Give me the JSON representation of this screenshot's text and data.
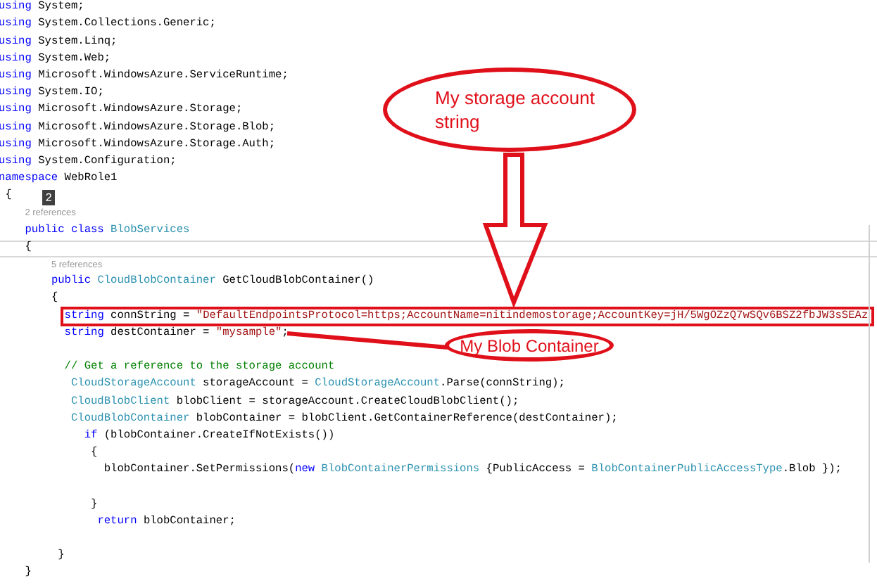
{
  "editor": {
    "lines": [
      {
        "kind": "code",
        "tokens": [
          {
            "kind": "keyword",
            "text": "using"
          },
          {
            "kind": "plain",
            "text": " System;"
          }
        ]
      },
      {
        "kind": "code",
        "tokens": [
          {
            "kind": "keyword",
            "text": "using"
          },
          {
            "kind": "plain",
            "text": " System.Collections.Generic;"
          }
        ]
      },
      {
        "kind": "code",
        "tokens": [
          {
            "kind": "keyword",
            "text": "using"
          },
          {
            "kind": "plain",
            "text": " System.Linq;"
          }
        ]
      },
      {
        "kind": "code",
        "tokens": [
          {
            "kind": "keyword",
            "text": "using"
          },
          {
            "kind": "plain",
            "text": " System.Web;"
          }
        ]
      },
      {
        "kind": "code",
        "tokens": [
          {
            "kind": "keyword",
            "text": "using"
          },
          {
            "kind": "plain",
            "text": " Microsoft.WindowsAzure.ServiceRuntime;"
          }
        ]
      },
      {
        "kind": "code",
        "tokens": [
          {
            "kind": "keyword",
            "text": "using"
          },
          {
            "kind": "plain",
            "text": " System.IO;"
          }
        ]
      },
      {
        "kind": "code",
        "tokens": [
          {
            "kind": "keyword",
            "text": "using"
          },
          {
            "kind": "plain",
            "text": " Microsoft.WindowsAzure.Storage;"
          }
        ]
      },
      {
        "kind": "code",
        "tokens": [
          {
            "kind": "keyword",
            "text": "using"
          },
          {
            "kind": "plain",
            "text": " Microsoft.WindowsAzure.Storage.Blob;"
          }
        ]
      },
      {
        "kind": "code",
        "tokens": [
          {
            "kind": "keyword",
            "text": "using"
          },
          {
            "kind": "plain",
            "text": " Microsoft.WindowsAzure.Storage.Auth;"
          }
        ]
      },
      {
        "kind": "code",
        "tokens": [
          {
            "kind": "keyword",
            "text": "using"
          },
          {
            "kind": "plain",
            "text": " System.Configuration;"
          }
        ]
      },
      {
        "kind": "code",
        "tokens": [
          {
            "kind": "keyword",
            "text": "namespace"
          },
          {
            "kind": "plain",
            "text": " WebRole1"
          }
        ]
      },
      {
        "kind": "code",
        "badge": "2",
        "tokens": [
          {
            "kind": "plain",
            "text": " {"
          }
        ]
      },
      {
        "kind": "lens",
        "text": "    2 references"
      },
      {
        "kind": "code",
        "tokens": [
          {
            "kind": "keyword",
            "text": "    public class"
          },
          {
            "kind": "type",
            "text": " BlobServices"
          }
        ]
      },
      {
        "kind": "code",
        "current": true,
        "tokens": [
          {
            "kind": "plain",
            "text": "    {"
          }
        ]
      },
      {
        "kind": "lens",
        "text": "        5 references"
      },
      {
        "kind": "code",
        "tokens": [
          {
            "kind": "keyword",
            "text": "        public"
          },
          {
            "kind": "type",
            "text": " CloudBlobContainer"
          },
          {
            "kind": "plain",
            "text": " GetCloudBlobContainer()"
          }
        ]
      },
      {
        "kind": "code",
        "tokens": [
          {
            "kind": "plain",
            "text": "        {"
          }
        ]
      },
      {
        "kind": "code",
        "highlighted": true,
        "tokens": [
          {
            "kind": "keyword",
            "text": "          string"
          },
          {
            "kind": "plain",
            "text": " connString = "
          },
          {
            "kind": "string",
            "text": "\"DefaultEndpointsProtocol=https;AccountName=nitindemostorage;AccountKey=jH/5WgOZzQ7wSQv6BSZ2fbJW3sSEAz"
          }
        ]
      },
      {
        "kind": "code",
        "tokens": [
          {
            "kind": "keyword",
            "text": "          string"
          },
          {
            "kind": "plain",
            "text": " destContainer = "
          },
          {
            "kind": "string",
            "text": "\"mysample\""
          },
          {
            "kind": "plain",
            "text": ";"
          }
        ]
      },
      {
        "kind": "blank"
      },
      {
        "kind": "code",
        "tokens": [
          {
            "kind": "comment",
            "text": "          // Get a reference to the storage account"
          }
        ]
      },
      {
        "kind": "code",
        "tokens": [
          {
            "kind": "type",
            "text": "           CloudStorageAccount"
          },
          {
            "kind": "plain",
            "text": " storageAccount = "
          },
          {
            "kind": "type",
            "text": "CloudStorageAccount"
          },
          {
            "kind": "plain",
            "text": ".Parse(connString);"
          }
        ]
      },
      {
        "kind": "code",
        "tokens": [
          {
            "kind": "type",
            "text": "           CloudBlobClient"
          },
          {
            "kind": "plain",
            "text": " blobClient = storageAccount.CreateCloudBlobClient();"
          }
        ]
      },
      {
        "kind": "code",
        "tokens": [
          {
            "kind": "type",
            "text": "           CloudBlobContainer"
          },
          {
            "kind": "plain",
            "text": " blobContainer = blobClient.GetContainerReference(destContainer);"
          }
        ]
      },
      {
        "kind": "code",
        "tokens": [
          {
            "kind": "keyword",
            "text": "             if"
          },
          {
            "kind": "plain",
            "text": " (blobContainer.CreateIfNotExists())"
          }
        ]
      },
      {
        "kind": "code",
        "tokens": [
          {
            "kind": "plain",
            "text": "              {"
          }
        ]
      },
      {
        "kind": "code",
        "tokens": [
          {
            "kind": "plain",
            "text": "                blobContainer.SetPermissions("
          },
          {
            "kind": "keyword",
            "text": "new"
          },
          {
            "kind": "type",
            "text": " BlobContainerPermissions"
          },
          {
            "kind": "plain",
            "text": " {PublicAccess = "
          },
          {
            "kind": "type",
            "text": "BlobContainerPublicAccessType"
          },
          {
            "kind": "plain",
            "text": ".Blob });"
          }
        ]
      },
      {
        "kind": "blank"
      },
      {
        "kind": "code",
        "tokens": [
          {
            "kind": "plain",
            "text": "              }"
          }
        ]
      },
      {
        "kind": "code",
        "tokens": [
          {
            "kind": "keyword",
            "text": "               return"
          },
          {
            "kind": "plain",
            "text": " blobContainer;"
          }
        ]
      },
      {
        "kind": "blank"
      },
      {
        "kind": "code",
        "tokens": [
          {
            "kind": "plain",
            "text": "         }"
          }
        ]
      },
      {
        "kind": "code",
        "tokens": [
          {
            "kind": "plain",
            "text": "    }"
          }
        ]
      }
    ]
  },
  "annotations": [
    {
      "kind": "storage",
      "text": "My storage account string"
    },
    {
      "kind": "container",
      "text": "My Blob Container"
    }
  ]
}
